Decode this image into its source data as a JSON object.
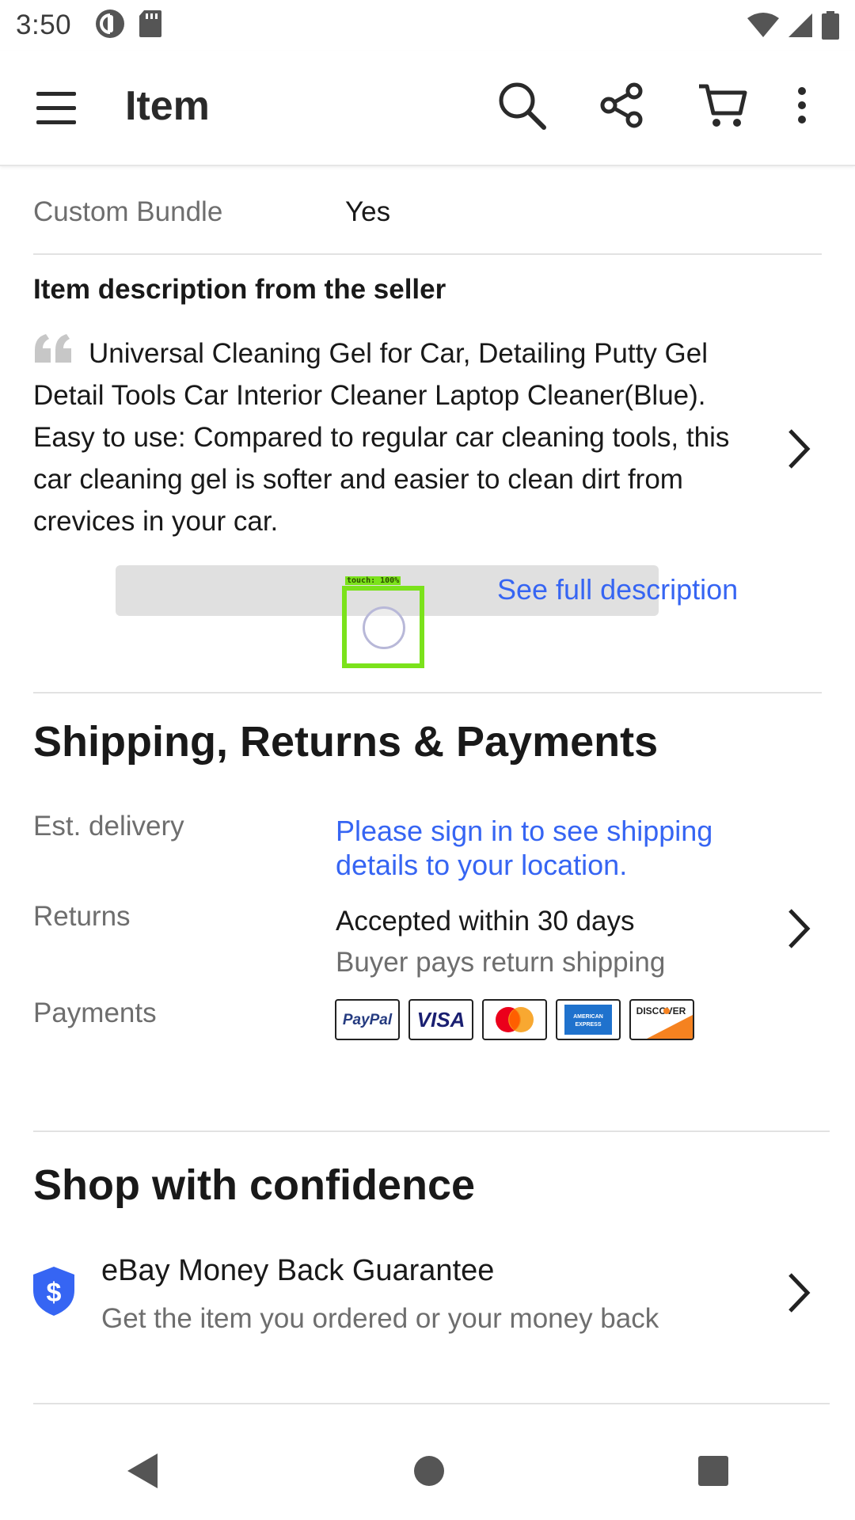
{
  "status_bar": {
    "time": "3:50"
  },
  "app_bar": {
    "title": "Item"
  },
  "specifics": {
    "custom_bundle_label": "Custom Bundle",
    "custom_bundle_value": "Yes"
  },
  "description": {
    "heading": "Item description from the seller",
    "text": "Universal Cleaning Gel for Car, Detailing Putty Gel Detail Tools Car Interior Cleaner Laptop Cleaner(Blue). Easy to use: Compared to regular car cleaning tools, this car cleaning gel is softer and easier to clean dirt from crevices in your car.",
    "see_full": "See full description"
  },
  "touch_overlay": {
    "label": "touch: 100%"
  },
  "shipping": {
    "title": "Shipping, Returns & Payments",
    "delivery_label": "Est. delivery",
    "delivery_value": "Please sign in to see shipping details to your location.",
    "returns_label": "Returns",
    "returns_value": "Accepted within 30 days",
    "returns_sub": "Buyer pays return shipping",
    "payments_label": "Payments",
    "payment_methods": [
      "PayPal",
      "VISA",
      "Mastercard",
      "American Express",
      "DISCOVER"
    ]
  },
  "confidence": {
    "title": "Shop with confidence",
    "guarantee_title": "eBay Money Back Guarantee",
    "guarantee_sub": "Get the item you ordered or your money back"
  },
  "colors": {
    "link": "#3665f3",
    "touch_highlight": "#7be21b",
    "shield": "#3665f3"
  }
}
